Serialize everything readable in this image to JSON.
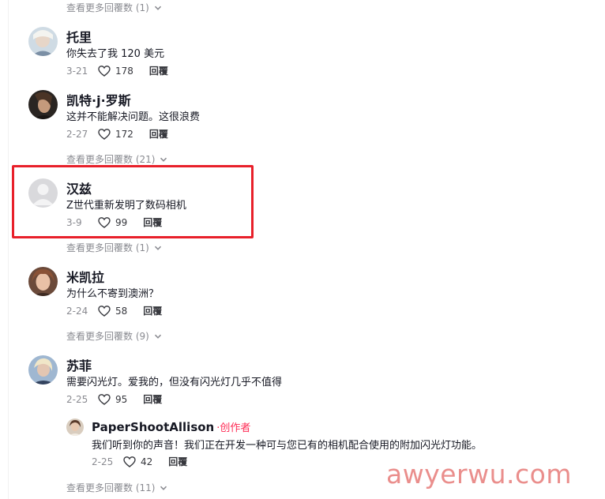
{
  "comments": [
    {
      "username": "托里",
      "text": "你失去了我 120 美元",
      "date": "3-21",
      "likes": "178",
      "reply_label": "回覆",
      "more_replies": null
    },
    {
      "username": "凯特·j·罗斯",
      "text": "这并不能解决问题。这很浪费",
      "date": "2-27",
      "likes": "172",
      "reply_label": "回覆",
      "more_replies": "查看更多回覆数 (21)"
    },
    {
      "username": "汉兹",
      "text": "Z世代重新发明了数码相机",
      "date": "3-9",
      "likes": "99",
      "reply_label": "回覆",
      "more_replies": "查看更多回覆数 (1)"
    },
    {
      "username": "米凯拉",
      "text": "为什么不寄到澳洲？",
      "date": "2-24",
      "likes": "58",
      "reply_label": "回覆",
      "more_replies": "查看更多回覆数 (9)"
    },
    {
      "username": "苏菲",
      "text": "需要闪光灯。爱我的，但没有闪光灯几乎不值得",
      "date": "2-25",
      "likes": "95",
      "reply_label": "回覆",
      "more_replies": null
    }
  ],
  "top_more_replies": "查看更多回覆数 (1)",
  "creator_reply": {
    "username": "PaperShootAllison",
    "tag": "·创作者",
    "text": "我们听到你的声音！我们正在开发一种可与您已有的相机配合使用的附加闪光灯功能。",
    "date": "2-25",
    "likes": "42",
    "reply_label": "回覆"
  },
  "bottom_more_replies": "查看更多回覆数 (11)",
  "watermark": "awyerwu.com",
  "colors": {
    "highlight": "#e8202a",
    "creator_tag": "#fe2c55",
    "watermark": "#ea8e8c",
    "muted": "#8a8b91"
  },
  "icons": {
    "like": "heart-outline-icon",
    "expand": "chevron-down-icon"
  }
}
